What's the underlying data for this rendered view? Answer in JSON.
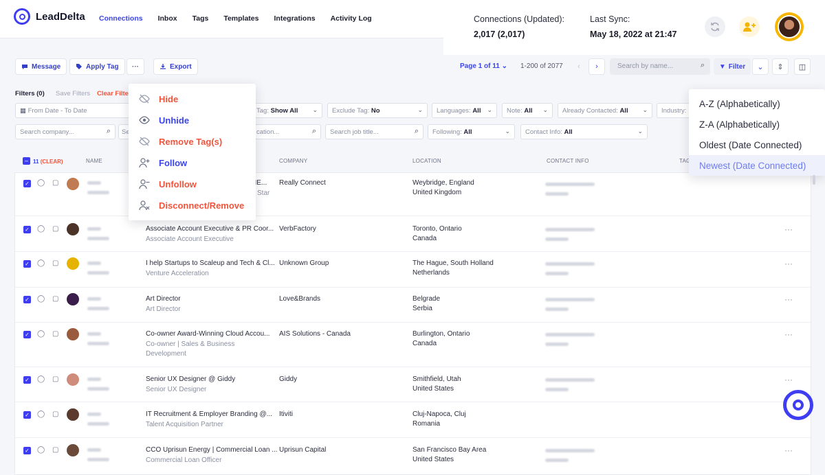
{
  "brand": {
    "name": "LeadDelta"
  },
  "nav": {
    "links": [
      {
        "label": "Connections",
        "active": true
      },
      {
        "label": "Inbox"
      },
      {
        "label": "Tags"
      },
      {
        "label": "Templates"
      },
      {
        "label": "Integrations"
      },
      {
        "label": "Activity Log"
      }
    ]
  },
  "stats": {
    "connections_label": "Connections (Updated):",
    "connections_value": "2,017 (2,017)",
    "sync_label": "Last Sync:",
    "sync_value": "May 18, 2022 at 21:47"
  },
  "toolbar": {
    "message": "Message",
    "apply_tag": "Apply Tag",
    "more": "···",
    "export": "Export"
  },
  "pagination": {
    "page": "Page 1 of 11",
    "range": "1-200 of 2077",
    "search_placeholder": "Search by name...",
    "filter": "Filter"
  },
  "filters": {
    "title": "Filters (0)",
    "save": "Save Filters",
    "clear": "Clear Filte",
    "date": "From Date - To Date",
    "tag_prefix": "Tag:",
    "tag_value": "Show All",
    "exclude_prefix": "Exclude Tag:",
    "exclude_value": "No",
    "languages_prefix": "Languages:",
    "languages_value": "All",
    "note_prefix": "Note:",
    "note_value": "All",
    "contacted_prefix": "Already Contacted:",
    "contacted_value": "All",
    "industry_prefix": "Industry:",
    "company_placeholder": "Search company...",
    "company_stub": "Se",
    "location_placeholder": "cation...",
    "job_placeholder": "Search job title...",
    "following_prefix": "Following:",
    "following_value": "All",
    "contact_prefix": "Contact Info:",
    "contact_value": "All"
  },
  "table": {
    "selected_count": "11",
    "clear": "(CLEAR)",
    "headers": {
      "name": "NAME",
      "company": "COMPANY",
      "location": "LOCATION",
      "contact": "CONTACT INFO",
      "tags": "TAG"
    },
    "rows": [
      {
        "title": "NE...",
        "subtitle": "Star",
        "company": "Really Connect",
        "loc1": "Weybridge, England",
        "loc2": "United Kingdom",
        "avcolor": "#c07b52"
      },
      {
        "title": "Associate Account Executive & PR Coor...",
        "subtitle": "Associate Account Executive",
        "company": "VerbFactory",
        "loc1": "Toronto, Ontario",
        "loc2": "Canada",
        "avcolor": "#4b3327"
      },
      {
        "title": "I help Startups to Scaleup and Tech & Cl...",
        "subtitle": "Venture Acceleration",
        "company": "Unknown Group",
        "loc1": "The Hague, South Holland",
        "loc2": "Netherlands",
        "avcolor": "#e6b400"
      },
      {
        "title": "Art Director",
        "subtitle": "Art Director",
        "company": "Love&Brands",
        "loc1": "Belgrade",
        "loc2": "Serbia",
        "avcolor": "#3a1d4a"
      },
      {
        "title": "Co-owner Award-Winning Cloud Accou...",
        "subtitle": "Co-owner | Sales & Business",
        "subtitle2": "Development",
        "company": "AIS Solutions - Canada",
        "loc1": "Burlington, Ontario",
        "loc2": "Canada",
        "avcolor": "#9a5b3c"
      },
      {
        "title": "Senior UX Designer @ Giddy",
        "subtitle": "Senior UX Designer",
        "company": "Giddy",
        "loc1": "Smithfield, Utah",
        "loc2": "United States",
        "avcolor": "#d08c7a"
      },
      {
        "title": "IT Recruitment & Employer Branding @...",
        "subtitle": "Talent Acquisition Partner",
        "company": "Itiviti",
        "loc1": "Cluj-Napoca, Cluj",
        "loc2": "Romania",
        "avcolor": "#5b3a2d"
      },
      {
        "title": "CCO Uprisun Energy | Commercial Loan ...",
        "subtitle": "Commercial Loan Officer",
        "company": "Uprisun Capital",
        "loc1": "San Francisco Bay Area",
        "loc2": "United States",
        "avcolor": "#6b4a3a"
      }
    ]
  },
  "action_menu": {
    "items": [
      {
        "label": "Hide",
        "tone": "red",
        "icon": "eye-off-icon"
      },
      {
        "label": "Unhide",
        "tone": "blue",
        "icon": "eye-icon"
      },
      {
        "label": "Remove Tag(s)",
        "tone": "red",
        "icon": "eye-off-icon"
      },
      {
        "label": "Follow",
        "tone": "blue",
        "icon": "user-plus-icon"
      },
      {
        "label": "Unfollow",
        "tone": "red",
        "icon": "user-minus-icon"
      },
      {
        "label": "Disconnect/Remove",
        "tone": "red",
        "icon": "user-x-icon"
      }
    ]
  },
  "sort_menu": {
    "options": [
      "A-Z (Alphabetically)",
      "Z-A (Alphabetically)",
      "Oldest (Date Connected)",
      "Newest (Date Connected)"
    ],
    "selected": "Newest (Date Connected)"
  },
  "colors": {
    "accent": "#3b45e8",
    "danger": "#f0543b"
  }
}
